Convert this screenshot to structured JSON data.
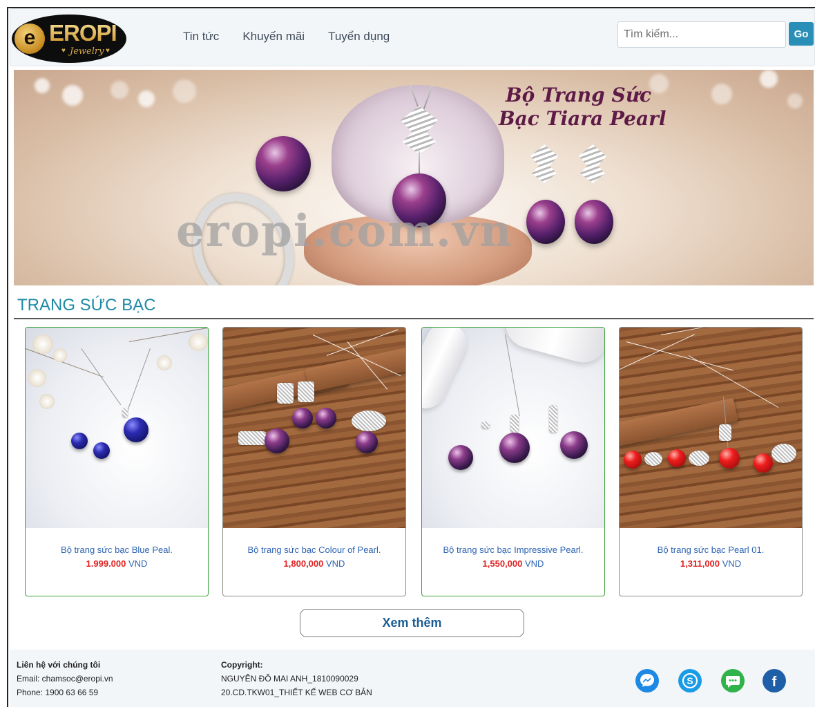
{
  "header": {
    "logo": {
      "brand": "EROPI",
      "tagline": "Jewelry",
      "icon": "eropi-logo-icon"
    },
    "nav": [
      {
        "label": "Tin tức"
      },
      {
        "label": "Khuyến mãi"
      },
      {
        "label": "Tuyển dụng"
      }
    ],
    "search": {
      "placeholder": "Tìm kiếm...",
      "value": "",
      "button_label": "Go"
    }
  },
  "banner": {
    "title_line1": "Bộ Trang Sức",
    "title_line2": "Bạc Tiara Pearl",
    "watermark": "eropi.com.vn"
  },
  "section": {
    "title": "TRANG SỨC BẠC",
    "products": [
      {
        "name": "Bộ trang sức bạc Blue Peal.",
        "price": "1.999.000",
        "currency": "VND",
        "highlighted": true
      },
      {
        "name": "Bộ trang sức bạc Colour of Pearl.",
        "price": "1,800,000",
        "currency": "VND",
        "highlighted": false
      },
      {
        "name": "Bộ trang sức bạc Impressive Pearl.",
        "price": "1,550,000",
        "currency": "VND",
        "highlighted": true
      },
      {
        "name": "Bộ trang sức bạc Pearl 01.",
        "price": "1,311,000",
        "currency": "VND",
        "highlighted": false
      }
    ],
    "more_button": "Xem thêm"
  },
  "footer": {
    "contact": {
      "heading": "Liên hệ với chúng tôi",
      "email": "Email: chamsoc@eropi.vn",
      "phone": "Phone: 1900 63 66 59"
    },
    "copyright": {
      "heading": "Copyright:",
      "line1": "NGUYỄN ĐỖ MAI ANH_1810090029",
      "line2": "20.CD.TKW01_THIẾT KẾ WEB CƠ BẢN"
    },
    "social": [
      {
        "icon": "messenger-icon",
        "color": "#1e88e5"
      },
      {
        "icon": "skype-icon",
        "color": "#1a9be6"
      },
      {
        "icon": "chat-icon",
        "color": "#2fb34a"
      },
      {
        "icon": "facebook-icon",
        "color": "#1f5fa8"
      }
    ]
  },
  "colors": {
    "accent": "#1f8aa5",
    "go_button": "#2a8fb6",
    "price": "#e02424",
    "product_name": "#2c63b3",
    "highlight_border": "#3aa23a"
  }
}
